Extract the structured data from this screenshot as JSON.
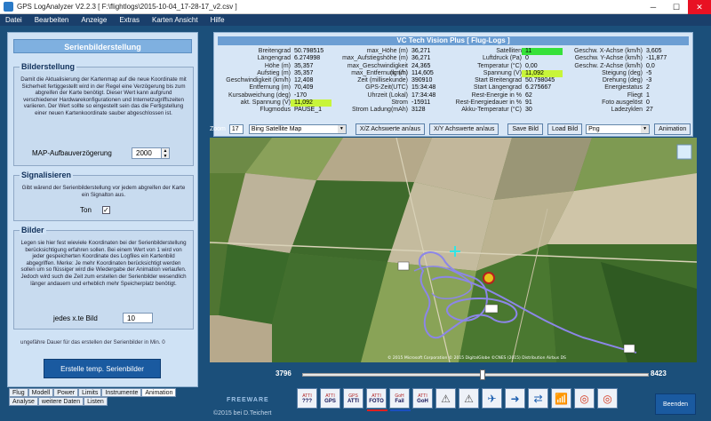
{
  "window": {
    "title": "GPS LogAnalyzer V2.2.3   [ F:\\flightlogs\\2015-10-04_17-28-17_v2.csv ]"
  },
  "menu": [
    "Datei",
    "Bearbeiten",
    "Anzeige",
    "Extras",
    "Karten Ansicht",
    "Hilfe"
  ],
  "left": {
    "header": "Serienbilderstellung",
    "bilderstellung": {
      "title": "Bilderstellung",
      "desc": "Damit die Aktualisierung der Kartenmap auf die neue Koordinate mit Sicherheit fertiggestellt wird in der Regel eine Verzögerung bis zum abgreifen der Karte benötigt. Dieser Wert kann aufgrund verschiedener Hardwarekonfigurationen und Internetzugriffszeiten variieren. Der Wert sollte so eingestellt sein das die Fertigstellung einer neuen Kartenkoordinate sauber abgeschlossen ist.",
      "label": "MAP-Aufbauverzögerung",
      "value": "2000"
    },
    "signalisieren": {
      "title": "Signalisieren",
      "desc": "Gibt wärend der Serienbilderstellung vor jedem abgreifen der Karte ein Signalton aus.",
      "label": "Ton",
      "checked": "✓"
    },
    "bilder": {
      "title": "Bilder",
      "desc": "Legen sie hier fest wieviele Koordinaten bei der Serienbilderstellung berücksichtigung erfahren sollen. Bei einem Wert von 1 wird von jeder gespeicherten Koordinate des Logfiles ein Kartenbild abgegriffen. Merke: Je mehr Koordinaten berücksichtigt werden sollen um so flüssiger wird die Wiedergabe der Animation verlaufen. Jedoch wird such die Zeit zum erstellen der Serienbilder wesendlich länger andauern und erheblich mehr Speicherplatz benötigt.",
      "label": "jedes x.te Bild",
      "value": "10"
    },
    "note": "ungefähre Dauer für das erstellen der Serienbilder in Min. 0",
    "button": "Erstelle temp. Serienbilder"
  },
  "tabs": {
    "row1": [
      "Flug",
      "Modell",
      "Power",
      "Limits",
      "Instrumente",
      "Animation"
    ],
    "row2": [
      "Analyse",
      "weitere Daten",
      "Listen"
    ],
    "active": "Animation"
  },
  "info": {
    "header": "VC Tech Vision Plus [ Flug-Logs ]",
    "col1": [
      [
        "Breitengrad",
        "50.798515"
      ],
      [
        "Längengrad",
        "6.274998"
      ],
      [
        "Höhe (m)",
        "35,357"
      ],
      [
        "Aufstieg (m)",
        "35,357"
      ],
      [
        "Geschwindigkeit (km/h)",
        "12,408"
      ],
      [
        "Entfernung (m)",
        "70,409"
      ],
      [
        "Kursabweichung (deg)",
        "-170"
      ],
      [
        "akt. Spannung (V)",
        "11,092"
      ],
      [
        "Flugmodus",
        "PAUSE_1"
      ]
    ],
    "col2": [
      [
        "max_Höhe (m)",
        "36,271"
      ],
      [
        "max_Aufstiegshöhe (m)",
        "36,271"
      ],
      [
        "max_Geschwindigkeit (km/h)",
        "24,365"
      ],
      [
        "max_Entfernung (m)",
        "114,605"
      ],
      [
        "Zeit (millisekunde)",
        "390910"
      ],
      [
        "GPS-Zeit(UTC)",
        "15:34:48"
      ],
      [
        "Uhrzeit (Lokal)",
        "17:34:48"
      ],
      [
        "Strom",
        "-15911"
      ],
      [
        "Strom Ladung(mAh)",
        "3128"
      ]
    ],
    "col3": [
      [
        "Satelliten",
        "11"
      ],
      [
        "Luftdruck (Pa)",
        "0"
      ],
      [
        "Temperatur (°C)",
        "0,00"
      ],
      [
        "Spannung (V)",
        "11,092"
      ],
      [
        "Start Breitengrad",
        "50.798045"
      ],
      [
        "Start Längengrad",
        "6.275667"
      ],
      [
        "Rest-Energie in %",
        "62"
      ],
      [
        "Rest-Energiedauer in %",
        "91"
      ],
      [
        "Akku-Temperatur (°C)",
        "30"
      ]
    ],
    "col4": [
      [
        "Geschw. X-Achse (km/h)",
        "3,605"
      ],
      [
        "Geschw. Y-Achse (km/h)",
        "-11,877"
      ],
      [
        "Geschw. Z-Achse (km/h)",
        "0,0"
      ],
      [
        "Steigung (deg)",
        "-5"
      ],
      [
        "Drehung (deg)",
        "-3"
      ],
      [
        "Energiestatus",
        "2"
      ],
      [
        "Fliegt",
        "1"
      ],
      [
        "Foto ausgelöst",
        "0"
      ],
      [
        "Ladezyklen",
        "27"
      ]
    ]
  },
  "toolbar": {
    "zoom_label": "Zoom",
    "zoom_value": "17",
    "map_type": "Bing Satellite Map",
    "btn_x": "X/Z Achswerte an/aus",
    "btn_y": "X/Y Achswerte an/aus",
    "btn_save": "Save Bild",
    "btn_load": "Load Bild",
    "format": "Png",
    "btn_anim": "Animation"
  },
  "map": {
    "attribution": "© 2015 Microsoft Corporation © 2015 DigitalGlobe ©CNES (2015) Distribution Airbus DS"
  },
  "slider": {
    "min": "3796",
    "max": "8423",
    "position": 0.52
  },
  "footer": {
    "freeware": "FREEWARE",
    "copyright": "©2015  bei D.Teichert"
  },
  "icons": [
    {
      "top": "ATTI",
      "bottom": "???",
      "bar": "",
      "name": "atti-unknown-icon"
    },
    {
      "top": "ATTI",
      "bottom": "GPS",
      "bar": "",
      "name": "atti-gps-icon"
    },
    {
      "top": "GPS",
      "bottom": "ATTI",
      "bar": "",
      "name": "gps-atti-icon"
    },
    {
      "top": "ATTI",
      "bottom": "FOTO",
      "bar": "#e02020",
      "name": "atti-foto-icon"
    },
    {
      "top": "GoH",
      "bottom": "Fail",
      "bar": "#1a4fc0",
      "name": "goh-fail-icon"
    },
    {
      "top": "ATTI",
      "bottom": "GoH",
      "bar": "",
      "name": "atti-goh-icon"
    },
    {
      "top": "",
      "bottom": "",
      "bar": "",
      "name": "warning-ok-icon"
    },
    {
      "top": "",
      "bottom": "",
      "bar": "",
      "name": "warning-alert-icon"
    },
    {
      "top": "",
      "bottom": "",
      "bar": "",
      "name": "satellite-icon"
    },
    {
      "top": "",
      "bottom": "",
      "bar": "",
      "name": "satellite-arrow-icon"
    },
    {
      "top": "",
      "bottom": "",
      "bar": "",
      "name": "sync-icon"
    },
    {
      "top": "",
      "bottom": "",
      "bar": "",
      "name": "signal-icon"
    },
    {
      "top": "",
      "bottom": "",
      "bar": "",
      "name": "target-home-icon"
    },
    {
      "top": "",
      "bottom": "",
      "bar": "",
      "name": "target-arrow-icon"
    }
  ],
  "exit_button": "Beenden",
  "colors": {
    "background": "#1b4f7a",
    "panel": "#cfe2f5",
    "track": "#8c86e8",
    "accent": "#1a5aa0"
  }
}
